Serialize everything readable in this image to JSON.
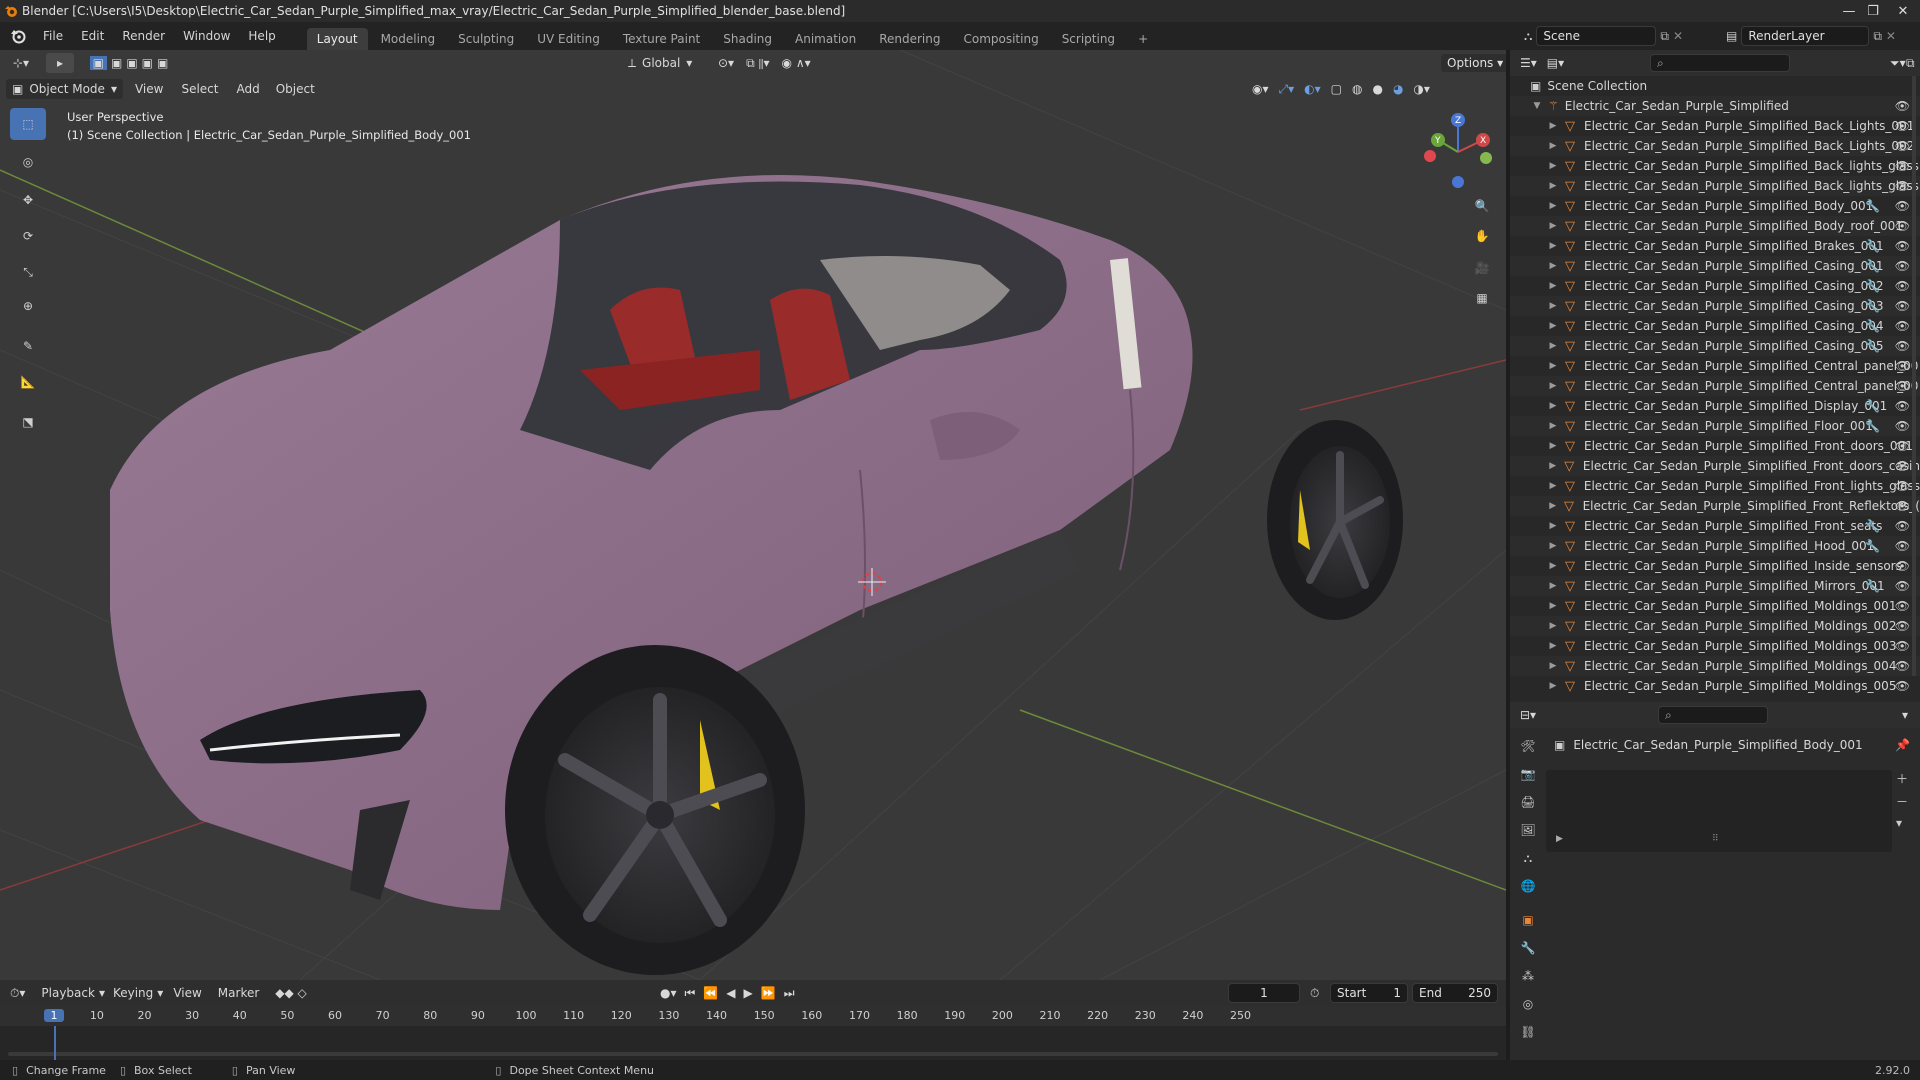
{
  "app": {
    "title": "Blender [C:\\Users\\I5\\Desktop\\Electric_Car_Sedan_Purple_Simplified_max_vray/Electric_Car_Sedan_Purple_Simplified_blender_base.blend]",
    "version": "2.92.0"
  },
  "menu": [
    "File",
    "Edit",
    "Render",
    "Window",
    "Help"
  ],
  "workspaces": [
    {
      "label": "Layout",
      "active": true
    },
    {
      "label": "Modeling",
      "active": false
    },
    {
      "label": "Sculpting",
      "active": false
    },
    {
      "label": "UV Editing",
      "active": false
    },
    {
      "label": "Texture Paint",
      "active": false
    },
    {
      "label": "Shading",
      "active": false
    },
    {
      "label": "Animation",
      "active": false
    },
    {
      "label": "Rendering",
      "active": false
    },
    {
      "label": "Compositing",
      "active": false
    },
    {
      "label": "Scripting",
      "active": false
    }
  ],
  "add_workspace": "+",
  "scene": {
    "label": "Scene",
    "render_layer": "RenderLayer"
  },
  "viewport": {
    "mode": "Object Mode",
    "header_menus": [
      "View",
      "Select",
      "Add",
      "Object"
    ],
    "transform_orientation": "Global",
    "options_label": "Options",
    "overlay_title": "User Perspective",
    "overlay_subtitle": "(1) Scene Collection | Electric_Car_Sedan_Purple_Simplified_Body_001",
    "gizmo": {
      "x": "X",
      "y": "Y",
      "z": "Z"
    }
  },
  "outliner": {
    "root": "Scene Collection",
    "collection": "Electric_Car_Sedan_Purple_Simplified",
    "items": [
      {
        "name": "Electric_Car_Sedan_Purple_Simplified_Back_Lights_001",
        "modifier": false
      },
      {
        "name": "Electric_Car_Sedan_Purple_Simplified_Back_Lights_002",
        "modifier": false
      },
      {
        "name": "Electric_Car_Sedan_Purple_Simplified_Back_lights_glass",
        "modifier": false
      },
      {
        "name": "Electric_Car_Sedan_Purple_Simplified_Back_lights_glass",
        "modifier": false
      },
      {
        "name": "Electric_Car_Sedan_Purple_Simplified_Body_001",
        "modifier": true
      },
      {
        "name": "Electric_Car_Sedan_Purple_Simplified_Body_roof_001",
        "modifier": false
      },
      {
        "name": "Electric_Car_Sedan_Purple_Simplified_Brakes_001",
        "modifier": true
      },
      {
        "name": "Electric_Car_Sedan_Purple_Simplified_Casing_001",
        "modifier": true
      },
      {
        "name": "Electric_Car_Sedan_Purple_Simplified_Casing_002",
        "modifier": true
      },
      {
        "name": "Electric_Car_Sedan_Purple_Simplified_Casing_003",
        "modifier": true
      },
      {
        "name": "Electric_Car_Sedan_Purple_Simplified_Casing_004",
        "modifier": true
      },
      {
        "name": "Electric_Car_Sedan_Purple_Simplified_Casing_005",
        "modifier": true
      },
      {
        "name": "Electric_Car_Sedan_Purple_Simplified_Central_panel_00",
        "modifier": false
      },
      {
        "name": "Electric_Car_Sedan_Purple_Simplified_Central_panel_00",
        "modifier": false
      },
      {
        "name": "Electric_Car_Sedan_Purple_Simplified_Display_001",
        "modifier": true
      },
      {
        "name": "Electric_Car_Sedan_Purple_Simplified_Floor_001",
        "modifier": true
      },
      {
        "name": "Electric_Car_Sedan_Purple_Simplified_Front_doors_001",
        "modifier": false
      },
      {
        "name": "Electric_Car_Sedan_Purple_Simplified_Front_doors_casin",
        "modifier": false
      },
      {
        "name": "Electric_Car_Sedan_Purple_Simplified_Front_lights_glass",
        "modifier": false
      },
      {
        "name": "Electric_Car_Sedan_Purple_Simplified_Front_Reflektors_(",
        "modifier": false
      },
      {
        "name": "Electric_Car_Sedan_Purple_Simplified_Front_seats",
        "modifier": true
      },
      {
        "name": "Electric_Car_Sedan_Purple_Simplified_Hood_001",
        "modifier": true
      },
      {
        "name": "Electric_Car_Sedan_Purple_Simplified_Inside_sensors",
        "modifier": false
      },
      {
        "name": "Electric_Car_Sedan_Purple_Simplified_Mirrors_001",
        "modifier": true
      },
      {
        "name": "Electric_Car_Sedan_Purple_Simplified_Moldings_001",
        "modifier": false
      },
      {
        "name": "Electric_Car_Sedan_Purple_Simplified_Moldings_002",
        "modifier": false
      },
      {
        "name": "Electric_Car_Sedan_Purple_Simplified_Moldings_003",
        "modifier": false
      },
      {
        "name": "Electric_Car_Sedan_Purple_Simplified_Moldings_004",
        "modifier": false
      },
      {
        "name": "Electric_Car_Sedan_Purple_Simplified_Moldings_005",
        "modifier": false
      }
    ]
  },
  "properties": {
    "object_name": "Electric_Car_Sedan_Purple_Simplified_Body_001"
  },
  "timeline": {
    "menus": [
      "Playback",
      "Keying",
      "View",
      "Marker"
    ],
    "current_frame": "1",
    "start_label": "Start",
    "start": "1",
    "end_label": "End",
    "end": "250",
    "ruler": [
      "1",
      "10",
      "20",
      "30",
      "40",
      "50",
      "60",
      "70",
      "80",
      "90",
      "100",
      "110",
      "120",
      "130",
      "140",
      "150",
      "160",
      "170",
      "180",
      "190",
      "200",
      "210",
      "220",
      "230",
      "240",
      "250"
    ]
  },
  "status": {
    "items": [
      "Change Frame",
      "Box Select",
      "Pan View",
      "Dope Sheet Context Menu"
    ]
  },
  "colors": {
    "accent": "#4772b3",
    "car_body": "#8a6a86",
    "mesh_icon": "#e8873a",
    "frame_marker": "#4772b3"
  }
}
